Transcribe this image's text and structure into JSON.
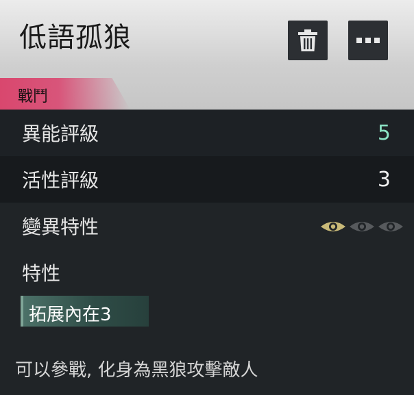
{
  "header": {
    "title": "低語孤狼",
    "delete_icon": "trash-icon",
    "more_icon": "ellipsis-icon"
  },
  "tag": {
    "label": "戰鬥"
  },
  "stats": [
    {
      "label": "異能評級",
      "value": "5",
      "color": "#8ce5c6"
    },
    {
      "label": "活性評級",
      "value": "3",
      "color": "#f2f2f2"
    }
  ],
  "mutation": {
    "label": "變異特性",
    "eyes_total": 3,
    "eyes_active": 1,
    "active_color": "#c8b978",
    "inactive_color": "#575a5d"
  },
  "traits": {
    "heading": "特性",
    "items": [
      {
        "label": "拓展內在3"
      }
    ]
  },
  "description": "可以參戰, 化身為黑狼攻擊敵人",
  "colors": {
    "accent_pink": "#d9476e",
    "background": "#202427"
  }
}
